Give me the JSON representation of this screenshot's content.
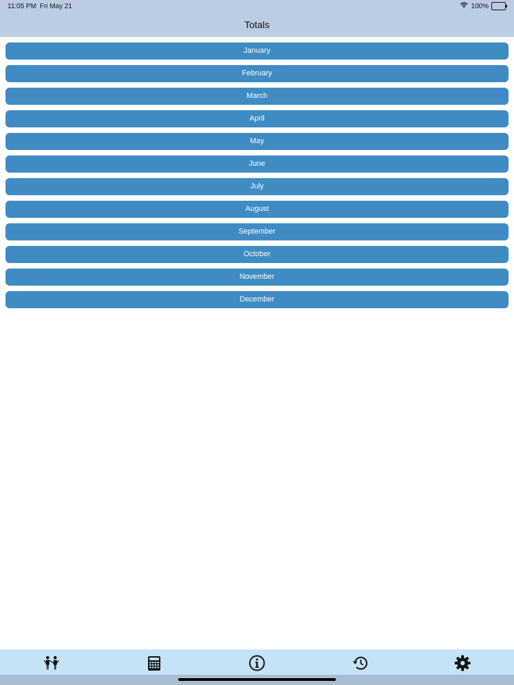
{
  "status_bar": {
    "time": "11:05 PM",
    "date": "Fri May 21",
    "battery": "100%"
  },
  "nav": {
    "title": "Totals"
  },
  "months": [
    {
      "label": "January"
    },
    {
      "label": "February"
    },
    {
      "label": "March"
    },
    {
      "label": "April"
    },
    {
      "label": "May"
    },
    {
      "label": "June"
    },
    {
      "label": "July"
    },
    {
      "label": "August"
    },
    {
      "label": "September"
    },
    {
      "label": "October"
    },
    {
      "label": "November"
    },
    {
      "label": "December"
    }
  ],
  "tab_bar": {
    "icons": [
      "people-icon",
      "calculator-icon",
      "info-icon",
      "history-icon",
      "gear-icon"
    ]
  },
  "colors": {
    "header_bg": "#bccde3",
    "button_bg": "#3f8cc4",
    "tab_bar_bg": "#c4e3f6"
  }
}
